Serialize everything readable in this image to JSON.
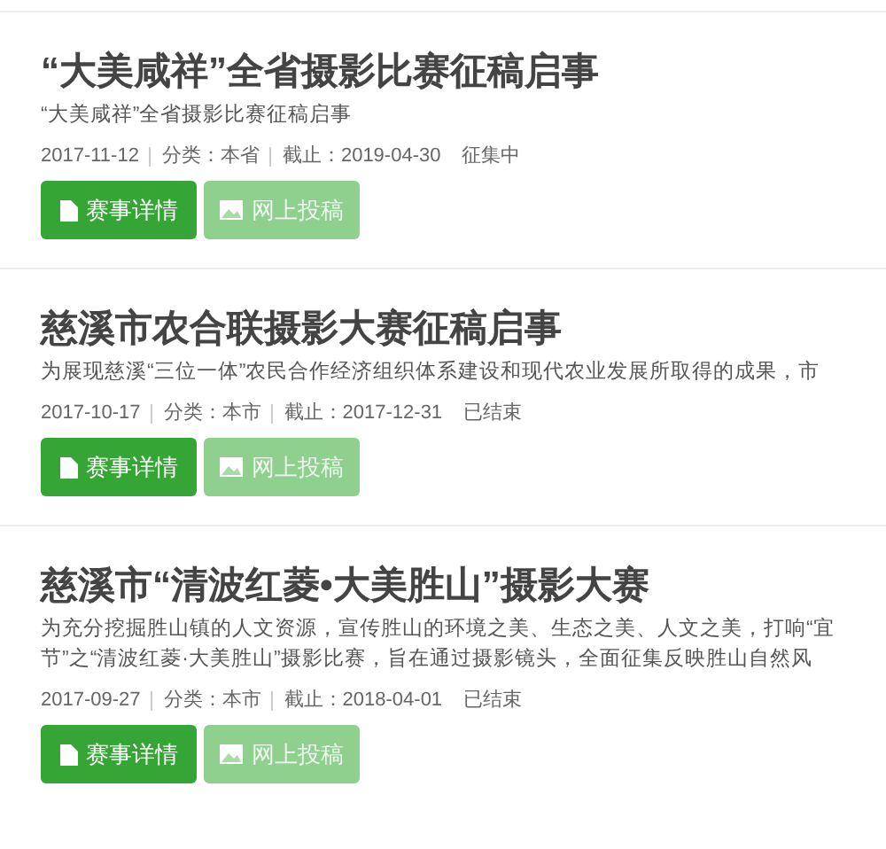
{
  "contests": [
    {
      "title": "“大美咸祥”全省摄影比赛征稿启事",
      "description_lines": [
        "“大美咸祥”全省摄影比赛征稿启事"
      ],
      "date": "2017-11-12",
      "category": "分类：本省",
      "deadline": "截止：2019-04-30",
      "status": "征集中",
      "buttons": [
        {
          "kind": "details",
          "label": "赛事详情"
        },
        {
          "kind": "submit",
          "label": "网上投稿"
        }
      ]
    },
    {
      "title": "慈溪市农合联摄影大赛征稿启事",
      "description_lines": [
        "为展现慈溪“三位一体”农民合作经济组织体系建设和现代农业发展所取得的成果，市"
      ],
      "date": "2017-10-17",
      "category": "分类：本市",
      "deadline": "截止：2017-12-31",
      "status": "已结束",
      "buttons": [
        {
          "kind": "details",
          "label": "赛事详情"
        },
        {
          "kind": "submit",
          "label": "网上投稿"
        }
      ]
    },
    {
      "title": "慈溪市“清波红菱•大美胜山”摄影大赛",
      "description_lines": [
        "为充分挖掘胜山镇的人文资源，宣传胜山的环境之美、生态之美、人文之美，打响“宜",
        "节”之“清波红菱·大美胜山”摄影比赛，旨在通过摄影镜头，全面征集反映胜山自然风"
      ],
      "date": "2017-09-27",
      "category": "分类：本市",
      "deadline": "截止：2018-04-01",
      "status": "已结束",
      "buttons": [
        {
          "kind": "details",
          "label": "赛事详情"
        },
        {
          "kind": "submit",
          "label": "网上投稿"
        }
      ]
    }
  ]
}
